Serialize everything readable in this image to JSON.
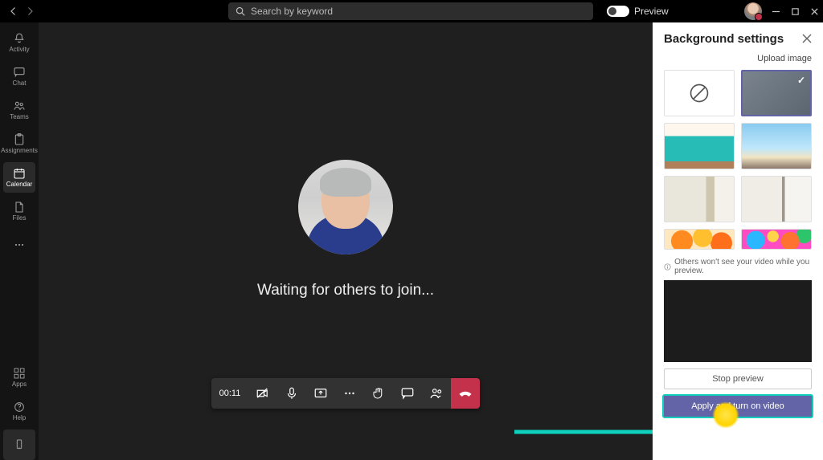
{
  "titlebar": {
    "search_placeholder": "Search by keyword",
    "preview_label": "Preview"
  },
  "nav": {
    "activity": "Activity",
    "chat": "Chat",
    "teams": "Teams",
    "assignments": "Assignments",
    "calendar": "Calendar",
    "files": "Files",
    "apps": "Apps",
    "help": "Help"
  },
  "meeting": {
    "waiting_text": "Waiting for others to join...",
    "timer": "00:11"
  },
  "panel": {
    "title": "Background settings",
    "upload_label": "Upload image",
    "info_text": "Others won't see your video while you preview.",
    "stop_label": "Stop preview",
    "apply_label": "Apply and turn on video"
  }
}
